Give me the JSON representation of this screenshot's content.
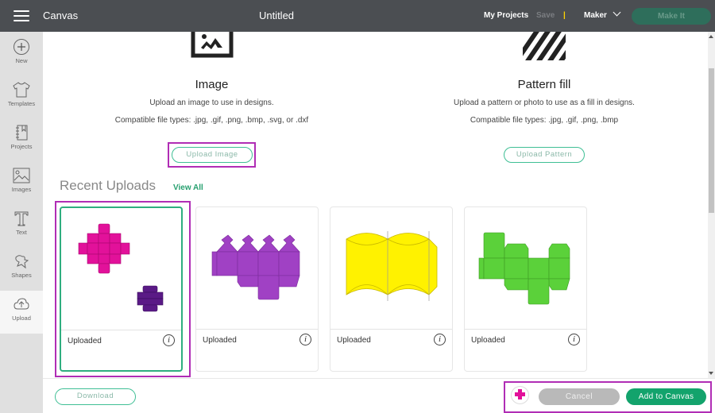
{
  "topbar": {
    "app_title": "Canvas",
    "document_title": "Untitled",
    "my_projects": "My Projects",
    "save": "Save",
    "separator": "|",
    "machine": "Maker",
    "make_it": "Make It"
  },
  "sidebar": {
    "items": [
      {
        "label": "New",
        "icon": "plus-circle-icon"
      },
      {
        "label": "Templates",
        "icon": "tshirt-icon"
      },
      {
        "label": "Projects",
        "icon": "notebook-icon"
      },
      {
        "label": "Images",
        "icon": "image-icon"
      },
      {
        "label": "Text",
        "icon": "text-t-icon"
      },
      {
        "label": "Shapes",
        "icon": "shapes-icon"
      },
      {
        "label": "Upload",
        "icon": "cloud-upload-icon",
        "active": true
      }
    ]
  },
  "upload_options": {
    "image": {
      "title": "Image",
      "description": "Upload an image to use in designs.",
      "file_types": "Compatible file types: .jpg, .gif, .png, .bmp, .svg, or .dxf",
      "button": "Upload Image"
    },
    "pattern": {
      "title": "Pattern fill",
      "description": "Upload a pattern or photo to use as a fill in designs.",
      "file_types": "Compatible file types: .jpg, .gif, .png, .bmp",
      "button": "Upload Pattern"
    }
  },
  "recent": {
    "title": "Recent Uploads",
    "view_all": "View All",
    "items": [
      {
        "caption": "Uploaded",
        "thumbnail": "pink and purple cube nets",
        "color": "#e2119a",
        "selected": true
      },
      {
        "caption": "Uploaded",
        "thumbnail": "purple box net",
        "color": "#9f3fbf"
      },
      {
        "caption": "Uploaded",
        "thumbnail": "yellow pillow box net",
        "color": "#fff200"
      },
      {
        "caption": "Uploaded",
        "thumbnail": "green box net",
        "color": "#5bd13a"
      }
    ],
    "info_glyph": "i"
  },
  "footer": {
    "download": "Download",
    "cancel": "Cancel",
    "add_to_canvas": "Add to Canvas"
  },
  "colors": {
    "topbar": "#4b4e52",
    "accent_green": "#13a36c",
    "outline_green": "#3fbf95",
    "highlight_magenta": "#b02db5"
  }
}
